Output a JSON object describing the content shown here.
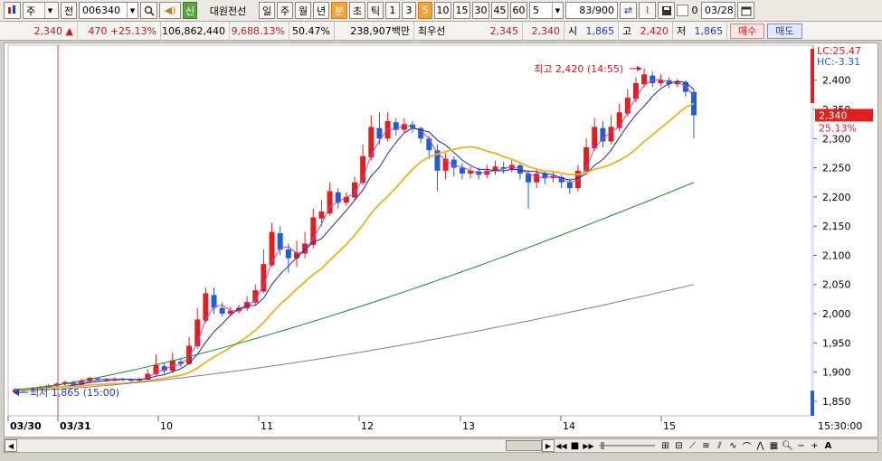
{
  "toolbar": {
    "market_select": "주",
    "scope_label": "전",
    "code": "006340",
    "badge_new": "신",
    "company": "대원전선",
    "period_day": "일",
    "period_week": "주",
    "period_month": "월",
    "period_year": "년",
    "period_minute": "분",
    "period_tick": "초",
    "period_tick2": "틱",
    "interval_1": "1",
    "interval_3": "3",
    "interval_5": "5",
    "interval_10": "10",
    "interval_15": "15",
    "interval_30": "30",
    "interval_45": "45",
    "interval_60": "60",
    "interval_custom": "5",
    "count": "83",
    "count_total": "/900",
    "date_value": "03/28",
    "zero_label": "0"
  },
  "info": {
    "price": "2,340",
    "arrow": "▲",
    "change": "470",
    "change_pct": "+25.13%",
    "volume": "106,862,440",
    "volume_pct": "9,688.13%",
    "ratio": "50.47%",
    "amount": "238,907백만",
    "bid_label": "최우선",
    "bid1": "2,345",
    "bid2": "2,340",
    "open_label": "시",
    "open": "1,865",
    "high_label": "고",
    "high": "2,420",
    "low_label": "저",
    "low": "1,865",
    "buy_label": "매수",
    "sell_label": "매도"
  },
  "chart_annotations": {
    "lc": "LC:25.47",
    "hc": "HC:-3.31",
    "high_note": "최고 2,420 (14:55)",
    "low_note": "최저 1,865 (15:00)",
    "current_price": "2,340",
    "current_pct": "25.13%",
    "time_label": "15:30:00"
  },
  "chart_data": {
    "type": "candlestick",
    "y_ticks": [
      "2,400",
      "2,350",
      "2,300",
      "2,250",
      "2,200",
      "2,150",
      "2,100",
      "2,050",
      "2,000",
      "1,950",
      "1,900",
      "1,850"
    ],
    "ylim": [
      1825,
      2460
    ],
    "x_labels": [
      "03/30",
      "03/31",
      "10",
      "11",
      "12",
      "13",
      "14",
      "15"
    ],
    "colors": {
      "up": "#e02020",
      "down": "#1f5fd6",
      "ma5": "#c040c0",
      "ma10": "#1c2a9a",
      "ma20": "#f0b020",
      "ma60": "#1a8a2a",
      "ma120": "#808080"
    },
    "candles": [
      [
        1865,
        1870,
        1862,
        1873
      ],
      [
        1868,
        1869,
        1865,
        1872
      ],
      [
        1870,
        1872,
        1866,
        1874
      ],
      [
        1871,
        1874,
        1869,
        1876
      ],
      [
        1873,
        1877,
        1871,
        1879
      ],
      [
        1876,
        1880,
        1873,
        1882
      ],
      [
        1879,
        1883,
        1876,
        1885
      ],
      [
        1882,
        1878,
        1875,
        1885
      ],
      [
        1878,
        1885,
        1876,
        1888
      ],
      [
        1884,
        1890,
        1881,
        1892
      ],
      [
        1889,
        1886,
        1884,
        1891
      ],
      [
        1886,
        1888,
        1883,
        1890
      ],
      [
        1887,
        1889,
        1884,
        1891
      ],
      [
        1888,
        1887,
        1884,
        1890
      ],
      [
        1887,
        1885,
        1883,
        1889
      ],
      [
        1885,
        1888,
        1883,
        1890
      ],
      [
        1887,
        1897,
        1885,
        1905
      ],
      [
        1896,
        1912,
        1894,
        1930
      ],
      [
        1910,
        1902,
        1896,
        1916
      ],
      [
        1902,
        1920,
        1898,
        1933
      ],
      [
        1918,
        1914,
        1908,
        1925
      ],
      [
        1914,
        1945,
        1912,
        1960
      ],
      [
        1944,
        1990,
        1940,
        2010
      ],
      [
        1988,
        2035,
        1984,
        2045
      ],
      [
        2032,
        2010,
        2000,
        2045
      ],
      [
        2010,
        2000,
        1995,
        2020
      ],
      [
        2000,
        2005,
        1995,
        2012
      ],
      [
        2004,
        2010,
        2000,
        2015
      ],
      [
        2009,
        2020,
        2005,
        2030
      ],
      [
        2019,
        2040,
        2015,
        2050
      ],
      [
        2038,
        2085,
        2035,
        2110
      ],
      [
        2083,
        2140,
        2080,
        2155
      ],
      [
        2138,
        2110,
        2100,
        2150
      ],
      [
        2110,
        2095,
        2070,
        2120
      ],
      [
        2095,
        2105,
        2080,
        2125
      ],
      [
        2103,
        2120,
        2095,
        2140
      ],
      [
        2118,
        2165,
        2112,
        2180
      ],
      [
        2163,
        2175,
        2150,
        2195
      ],
      [
        2172,
        2210,
        2168,
        2225
      ],
      [
        2208,
        2190,
        2180,
        2215
      ],
      [
        2190,
        2200,
        2185,
        2208
      ],
      [
        2199,
        2225,
        2195,
        2235
      ],
      [
        2224,
        2270,
        2220,
        2290
      ],
      [
        2268,
        2320,
        2262,
        2340
      ],
      [
        2318,
        2300,
        2290,
        2345
      ],
      [
        2300,
        2330,
        2295,
        2345
      ],
      [
        2328,
        2315,
        2305,
        2335
      ],
      [
        2315,
        2325,
        2310,
        2335
      ],
      [
        2324,
        2318,
        2310,
        2330
      ],
      [
        2318,
        2300,
        2292,
        2320
      ],
      [
        2300,
        2280,
        2265,
        2305
      ],
      [
        2280,
        2245,
        2210,
        2290
      ],
      [
        2245,
        2265,
        2230,
        2275
      ],
      [
        2264,
        2250,
        2235,
        2270
      ],
      [
        2250,
        2240,
        2230,
        2258
      ],
      [
        2240,
        2245,
        2232,
        2252
      ],
      [
        2244,
        2238,
        2230,
        2250
      ],
      [
        2238,
        2245,
        2232,
        2255
      ],
      [
        2244,
        2252,
        2238,
        2262
      ],
      [
        2251,
        2248,
        2240,
        2260
      ],
      [
        2248,
        2255,
        2242,
        2265
      ],
      [
        2254,
        2240,
        2230,
        2258
      ],
      [
        2240,
        2225,
        2180,
        2245
      ],
      [
        2225,
        2240,
        2215,
        2248
      ],
      [
        2240,
        2232,
        2222,
        2244
      ],
      [
        2232,
        2235,
        2225,
        2242
      ],
      [
        2234,
        2225,
        2215,
        2238
      ],
      [
        2225,
        2215,
        2205,
        2232
      ],
      [
        2215,
        2245,
        2210,
        2255
      ],
      [
        2244,
        2285,
        2240,
        2300
      ],
      [
        2283,
        2320,
        2278,
        2335
      ],
      [
        2318,
        2295,
        2285,
        2330
      ],
      [
        2295,
        2320,
        2290,
        2340
      ],
      [
        2318,
        2345,
        2312,
        2360
      ],
      [
        2343,
        2370,
        2338,
        2385
      ],
      [
        2368,
        2395,
        2362,
        2405
      ],
      [
        2393,
        2410,
        2388,
        2420
      ],
      [
        2408,
        2395,
        2388,
        2415
      ],
      [
        2395,
        2400,
        2390,
        2410
      ],
      [
        2400,
        2393,
        2386,
        2405
      ],
      [
        2393,
        2398,
        2388,
        2402
      ],
      [
        2397,
        2380,
        2372,
        2400
      ],
      [
        2380,
        2340,
        2300,
        2385
      ]
    ]
  },
  "scroll": {
    "left_arrow": "◀",
    "right_arrow": "▶",
    "prev": "◀◀",
    "stop": "■",
    "next": "▶▶",
    "zoom_minus": "−",
    "zoom_plus": "+",
    "text_tool": "A"
  }
}
